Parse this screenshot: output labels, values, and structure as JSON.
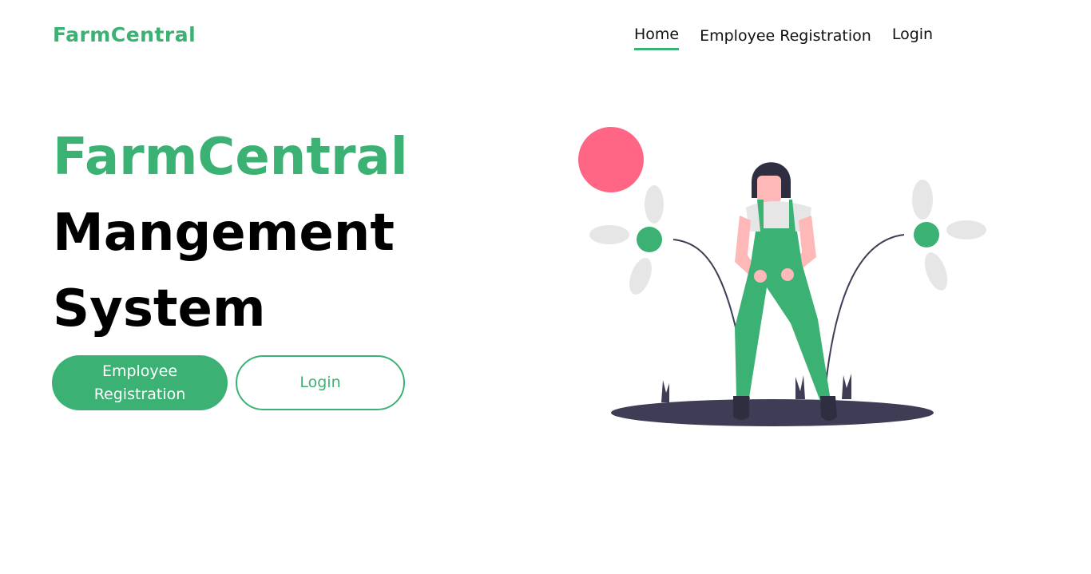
{
  "header": {
    "logo": "FarmCentral",
    "nav": {
      "home": "Home",
      "employee_registration": "Employee Registration",
      "login": "Login"
    }
  },
  "hero": {
    "title_line1": "FarmCentral",
    "title_line2": "Mangement",
    "title_line3": "System",
    "primary_button": "Employee Registration",
    "secondary_button": "Login"
  },
  "colors": {
    "brand": "#3bb273",
    "sun": "#ff6584",
    "ground": "#3f3d56",
    "petal": "#e6e6e6"
  },
  "illustration": {
    "icon": "woman-gardening-illustration"
  }
}
